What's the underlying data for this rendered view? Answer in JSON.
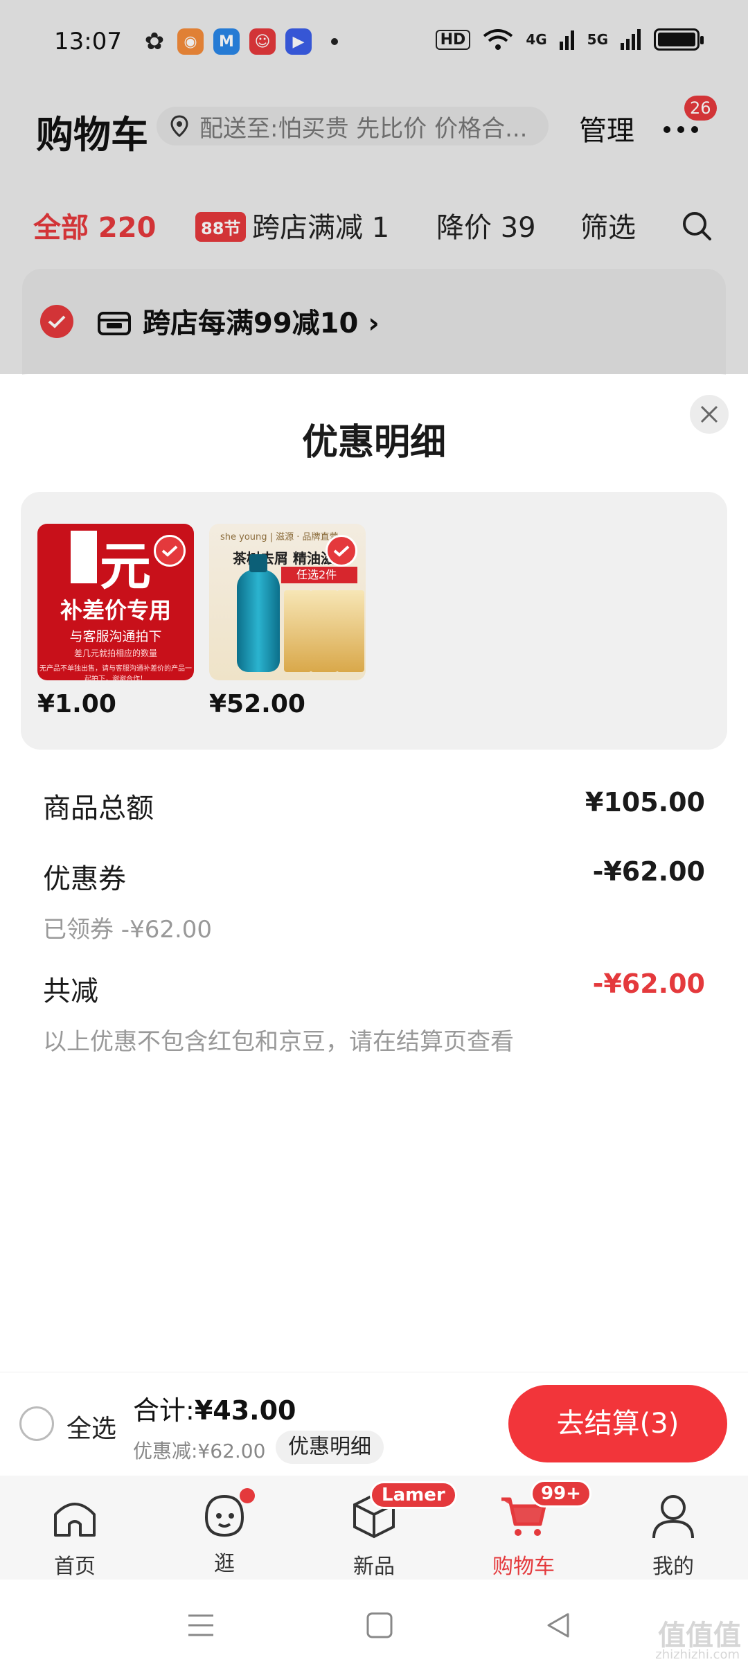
{
  "status_bar": {
    "time": "13:07",
    "hd_label": "HD",
    "network_4g": "4G",
    "network_5g": "5G"
  },
  "header": {
    "title": "购物车",
    "address_placeholder": "配送至:怕买贵 先比价 价格合...",
    "manage_label": "管理",
    "message_badge": "26"
  },
  "filters": {
    "all_label": "全部 220",
    "festival_badge": "88节",
    "cross_store_label": "跨店满减 1",
    "price_drop_label": "降价 39",
    "filter_label": "筛选"
  },
  "store_card": {
    "promo_text": "跨店每满99减10 ›"
  },
  "sheet": {
    "title": "优惠明细",
    "products": [
      {
        "price": "¥1.00",
        "image_text": {
          "big": "元",
          "line1": "补差价专用",
          "line2": "与客服沟通拍下",
          "line3": "差几元就拍相应的数量",
          "line4": "无产品不单独出售，请与客服沟通补差价的产品一起拍下，谢谢合作！"
        }
      },
      {
        "price": "¥52.00",
        "image_text": {
          "brand": "she young | 滋源 · 品牌直营",
          "headline": "茶树去屑 精油滋",
          "band": "任选2件"
        }
      }
    ],
    "rows": {
      "goods_total_label": "商品总额",
      "goods_total_value": "¥105.00",
      "coupon_label": "优惠券",
      "coupon_value": "-¥62.00",
      "coupon_sub": "已领券 -¥62.00",
      "total_reduce_label": "共减",
      "total_reduce_value": "-¥62.00",
      "note": "以上优惠不包含红包和京豆，请在结算页查看"
    }
  },
  "checkout": {
    "select_all_label": "全选",
    "total_label": "合计:",
    "total_value": "¥43.00",
    "discount_line": "优惠减:¥62.00",
    "detail_label": "优惠明细",
    "checkout_button": "去结算(3)"
  },
  "tabs": [
    {
      "label": "首页"
    },
    {
      "label": "逛"
    },
    {
      "label": "新品",
      "tag": "Lamer"
    },
    {
      "label": "购物车",
      "tag": "99+"
    },
    {
      "label": "我的"
    }
  ],
  "watermark": {
    "text": "值值值",
    "sub": "zhizhizhi.com"
  },
  "colors": {
    "accent": "#e4393c",
    "checkout_button": "#f2353a"
  }
}
